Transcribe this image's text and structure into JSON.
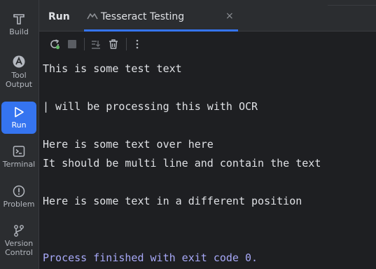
{
  "toolstrip": {
    "items": [
      {
        "label": "Build",
        "icon": "hammer-icon"
      },
      {
        "label": "Tool\nOutput",
        "icon": "tool-output-icon"
      },
      {
        "label": "Run",
        "icon": "run-icon",
        "active": true
      },
      {
        "label": "Terminal",
        "icon": "terminal-icon"
      },
      {
        "label": "Problem",
        "icon": "problem-icon"
      },
      {
        "label": "Version\nControl",
        "icon": "version-control-icon"
      }
    ]
  },
  "tabs": {
    "run_label": "Run",
    "active_tab_label": "Tesseract Testing",
    "close_glyph": "×"
  },
  "console": {
    "lines": [
      "This is some test text",
      "",
      "| will be processing this with OCR",
      "",
      "Here is some text over here",
      "It should be multi line and contain the text",
      "",
      "Here is some text in a different position",
      "",
      ""
    ],
    "exit_message": "Process finished with exit code 0."
  },
  "colors": {
    "accent": "#3574f0",
    "exit_text": "#a7a8f7",
    "console_text": "#dfe1e5",
    "background": "#1e1f22"
  }
}
